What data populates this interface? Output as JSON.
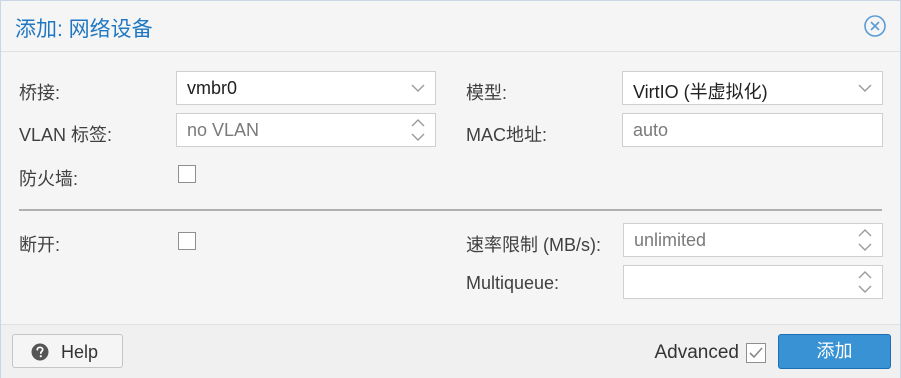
{
  "dialog": {
    "title": "添加: 网络设备"
  },
  "form": {
    "bridge": {
      "label": "桥接:",
      "value": "vmbr0"
    },
    "vlan_tag": {
      "label": "VLAN 标签:",
      "placeholder": "no VLAN"
    },
    "firewall": {
      "label": "防火墙:",
      "checked": false
    },
    "model": {
      "label": "模型:",
      "value": "VirtIO (半虚拟化)"
    },
    "mac_address": {
      "label": "MAC地址:",
      "placeholder": "auto"
    },
    "disconnect": {
      "label": "断开:",
      "checked": false
    },
    "rate_limit": {
      "label": "速率限制 (MB/s):",
      "placeholder": "unlimited"
    },
    "multiqueue": {
      "label": "Multiqueue:",
      "placeholder": ""
    }
  },
  "footer": {
    "help_label": "Help",
    "advanced_label": "Advanced",
    "advanced_checked": true,
    "add_label": "添加"
  },
  "colors": {
    "title": "#1f78c1",
    "primary_button": "#3892d4",
    "background": "#f5f5f5"
  },
  "icons": {
    "close": "close-circle-icon",
    "help": "question-circle-icon",
    "dropdown": "chevron-down-icon",
    "spinner": "spinner-arrows-icon"
  }
}
